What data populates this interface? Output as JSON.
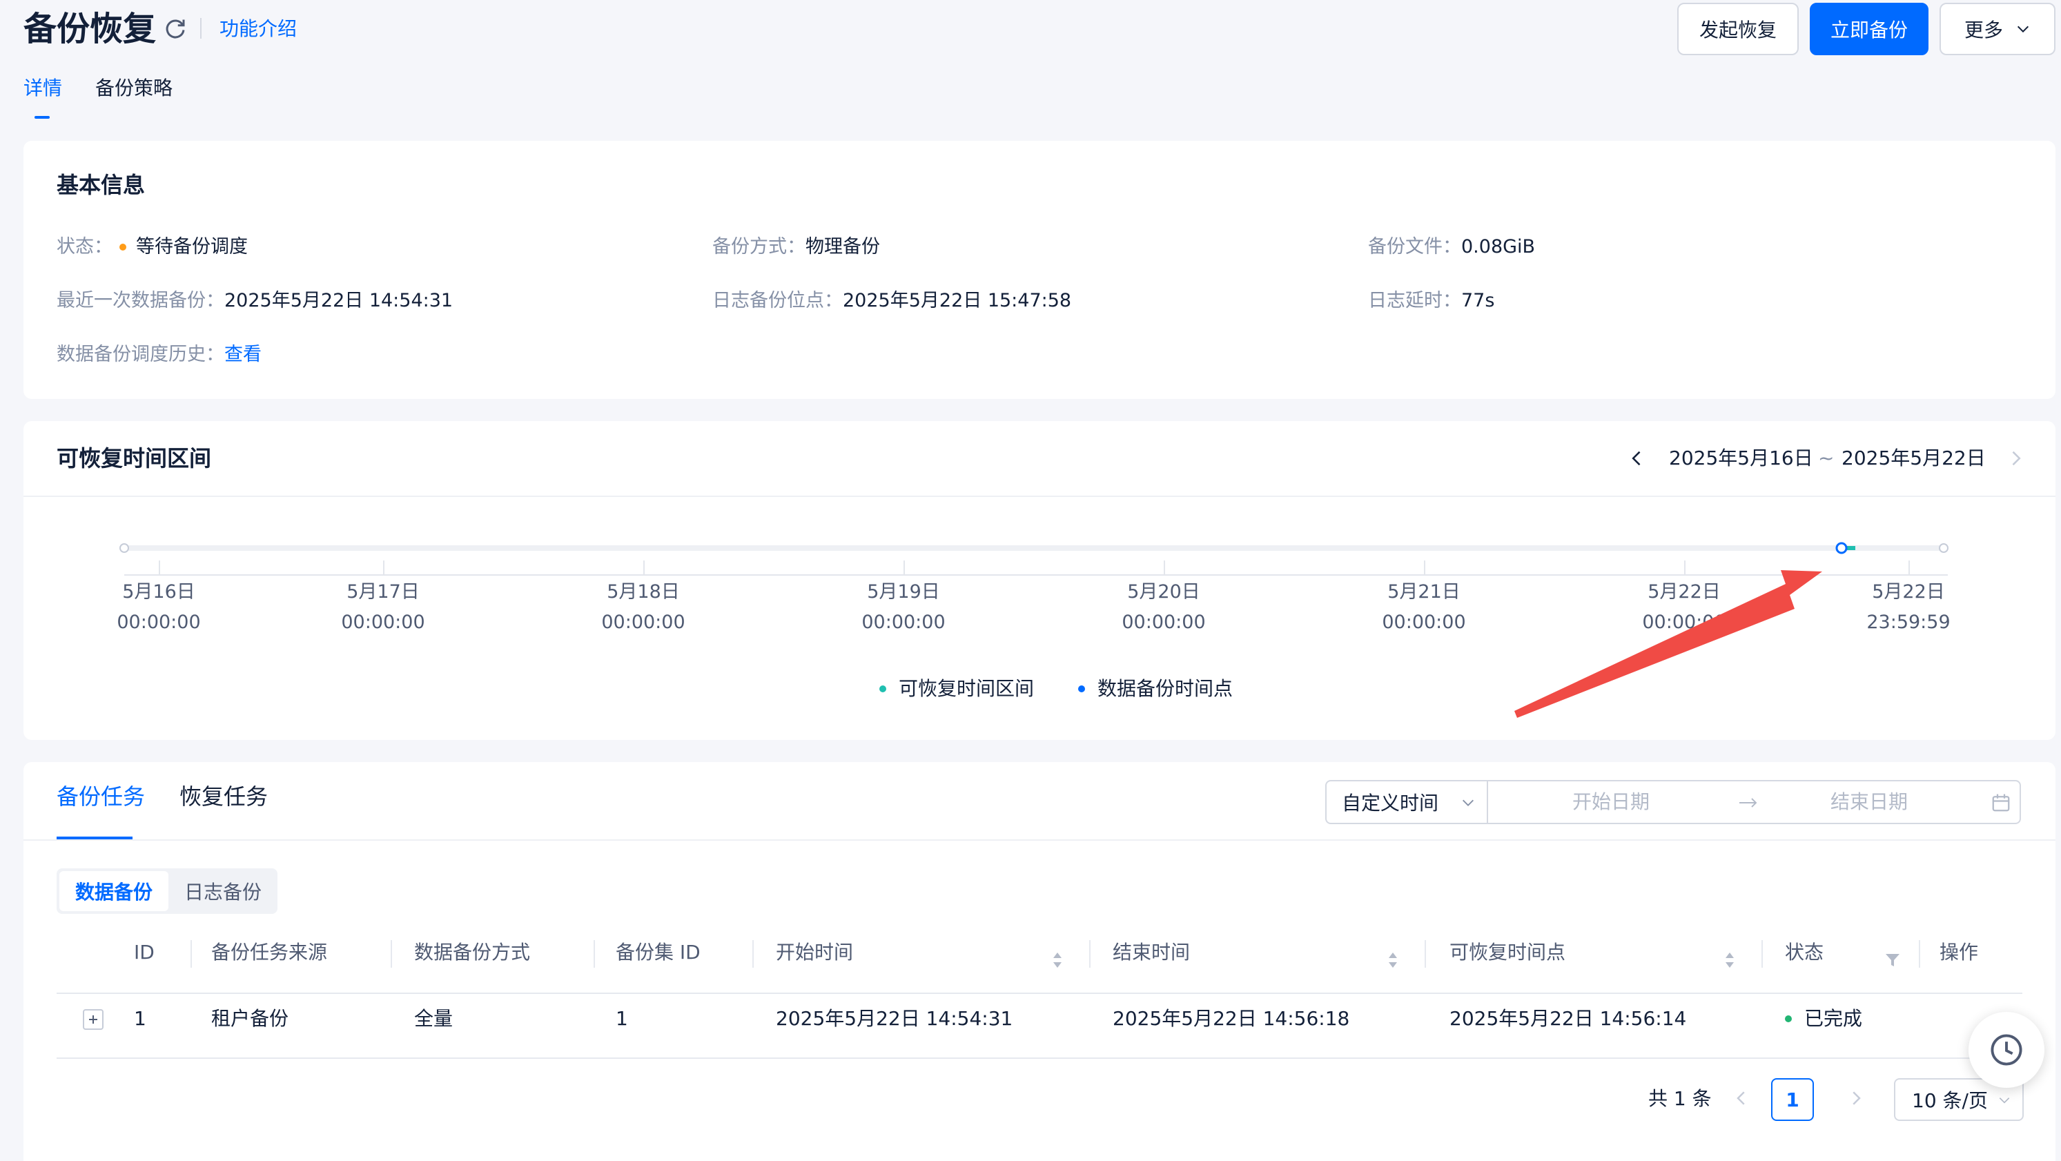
{
  "header": {
    "title": "备份恢复",
    "intro_link": "功能介绍",
    "actions": {
      "restore": "发起恢复",
      "backup_now": "立即备份",
      "more": "更多"
    }
  },
  "tabs": [
    {
      "label": "详情",
      "active": true
    },
    {
      "label": "备份策略",
      "active": false
    }
  ],
  "basic_info": {
    "title": "基本信息",
    "fields": {
      "status": {
        "label": "状态：",
        "value": "等待备份调度",
        "color": "#ff9c19"
      },
      "backup_method": {
        "label": "备份方式：",
        "value": "物理备份"
      },
      "backup_file": {
        "label": "备份文件：",
        "value": "0.08GiB"
      },
      "last_data_backup": {
        "label": "最近一次数据备份：",
        "value": "2025年5月22日 14:54:31"
      },
      "log_backup_point": {
        "label": "日志备份位点：",
        "value": "2025年5月22日 15:47:58"
      },
      "log_delay": {
        "label": "日志延时：",
        "value": "77s"
      },
      "history": {
        "label": "数据备份调度历史：",
        "link": "查看"
      }
    }
  },
  "recoverable_range": {
    "title": "可恢复时间区间",
    "range_start": "2025年5月16日",
    "range_sep": "~",
    "range_end": "2025年5月22日",
    "ticks": [
      {
        "date": "5月16日",
        "time": "00:00:00"
      },
      {
        "date": "5月17日",
        "time": "00:00:00"
      },
      {
        "date": "5月18日",
        "time": "00:00:00"
      },
      {
        "date": "5月19日",
        "time": "00:00:00"
      },
      {
        "date": "5月20日",
        "time": "00:00:00"
      },
      {
        "date": "5月21日",
        "time": "00:00:00"
      },
      {
        "date": "5月22日",
        "time": "00:00:00"
      },
      {
        "date": "5月22日",
        "time": "23:59:59"
      }
    ],
    "legend": {
      "recoverable": {
        "label": "可恢复时间区间",
        "color": "#1fbfb0"
      },
      "backup_point": {
        "label": "数据备份时间点",
        "color": "#006aff"
      }
    }
  },
  "tasks": {
    "tabs": [
      {
        "label": "备份任务",
        "active": true
      },
      {
        "label": "恢复任务",
        "active": false
      }
    ],
    "filter": {
      "time_select": "自定义时间",
      "start_placeholder": "开始日期",
      "end_placeholder": "结束日期"
    },
    "segments": [
      {
        "label": "数据备份",
        "active": true
      },
      {
        "label": "日志备份",
        "active": false
      }
    ],
    "columns": [
      "ID",
      "备份任务来源",
      "数据备份方式",
      "备份集 ID",
      "开始时间",
      "结束时间",
      "可恢复时间点",
      "状态",
      "操作"
    ],
    "rows": [
      {
        "id": "1",
        "source": "租户备份",
        "method": "全量",
        "backup_set_id": "1",
        "start": "2025年5月22日 14:54:31",
        "end": "2025年5月22日 14:56:18",
        "recoverable_point": "2025年5月22日 14:56:14",
        "status": "已完成",
        "status_color": "#22b573"
      }
    ],
    "pagination": {
      "total": "共 1 条",
      "current_page": "1",
      "page_size": "10 条/页"
    }
  },
  "colors": {
    "accent": "#006aff",
    "annotation_arrow": "#f04b45"
  }
}
